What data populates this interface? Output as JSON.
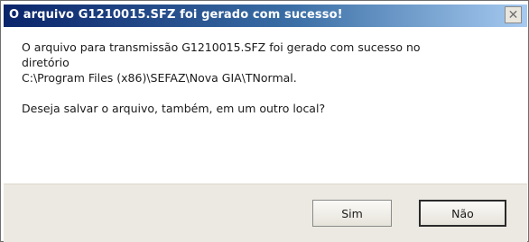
{
  "dialog": {
    "title": "O arquivo G1210015.SFZ foi gerado com sucesso!",
    "close_glyph": "✕",
    "message_line1": "O arquivo para transmissão G1210015.SFZ foi gerado com sucesso no",
    "message_line2": "diretório",
    "message_line3": "C:\\Program Files (x86)\\SEFAZ\\Nova GIA\\TNormal.",
    "question": "Deseja salvar o arquivo, também, em um outro local?",
    "buttons": {
      "yes_label": "Sim",
      "no_label": "Não"
    }
  },
  "icons": {
    "close": "close-icon"
  },
  "colors": {
    "titlebar_start": "#0a246a",
    "titlebar_end": "#a6caf0",
    "footer_bg": "#ece9e2"
  }
}
